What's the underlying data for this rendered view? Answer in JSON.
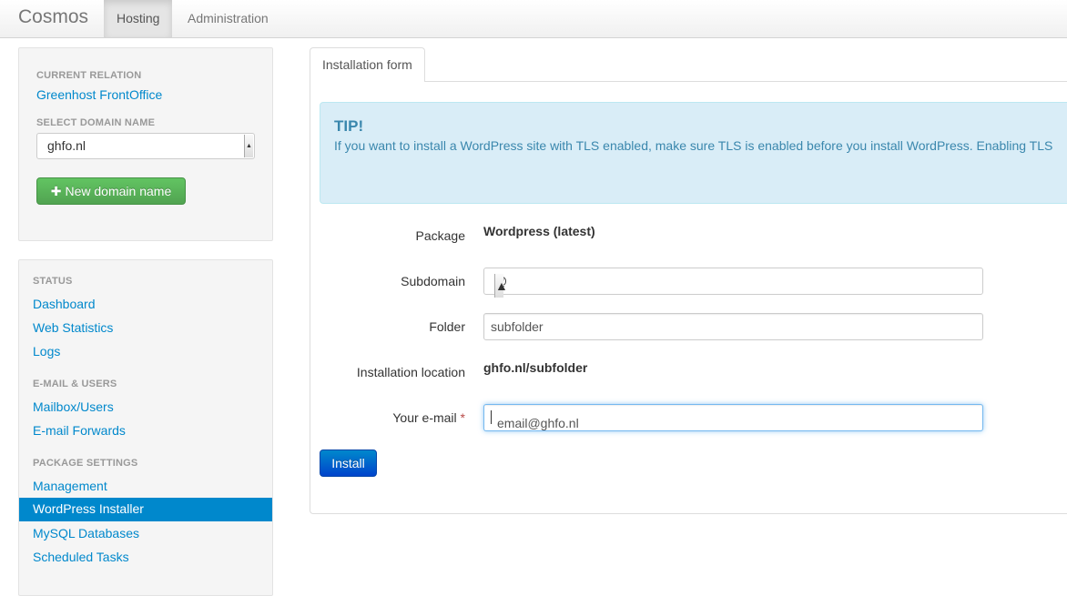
{
  "navbar": {
    "brand": "Cosmos",
    "tabs": [
      {
        "label": "Hosting",
        "active": true
      },
      {
        "label": "Administration",
        "active": false
      }
    ]
  },
  "sidebar": {
    "current_relation_heading": "CURRENT RELATION",
    "current_relation": "Greenhost FrontOffice",
    "select_domain_heading": "SELECT DOMAIN NAME",
    "selected_domain": "ghfo.nl",
    "new_domain_button": "New domain name",
    "sections": [
      {
        "heading": "STATUS",
        "items": [
          "Dashboard",
          "Web Statistics",
          "Logs"
        ]
      },
      {
        "heading": "E-MAIL & USERS",
        "items": [
          "Mailbox/Users",
          "E-mail Forwards"
        ]
      },
      {
        "heading": "PACKAGE SETTINGS",
        "items": [
          "Management",
          "WordPress Installer",
          "MySQL Databases",
          "Scheduled Tasks"
        ]
      }
    ],
    "active_item": "WordPress Installer"
  },
  "main": {
    "tab_label": "Installation form",
    "tip": {
      "title": "TIP!",
      "text": "If you want to install a WordPress site with TLS enabled, make sure TLS is enabled before you install WordPress. Enabling TLS"
    },
    "form": {
      "package_label": "Package",
      "package_value": "Wordpress (latest)",
      "subdomain_label": "Subdomain",
      "subdomain_value": "@",
      "folder_label": "Folder",
      "folder_value": "subfolder",
      "location_label": "Installation location",
      "location_value": "ghfo.nl/subfolder",
      "email_label": "Your e-mail",
      "email_required_mark": "*",
      "email_value": "email@ghfo.nl",
      "install_button": "Install"
    }
  },
  "colors": {
    "link": "#0088cc",
    "active_nav": "#0088cc",
    "success": "#51a351",
    "info_bg": "#d9edf7",
    "info_text": "#3a87ad"
  }
}
